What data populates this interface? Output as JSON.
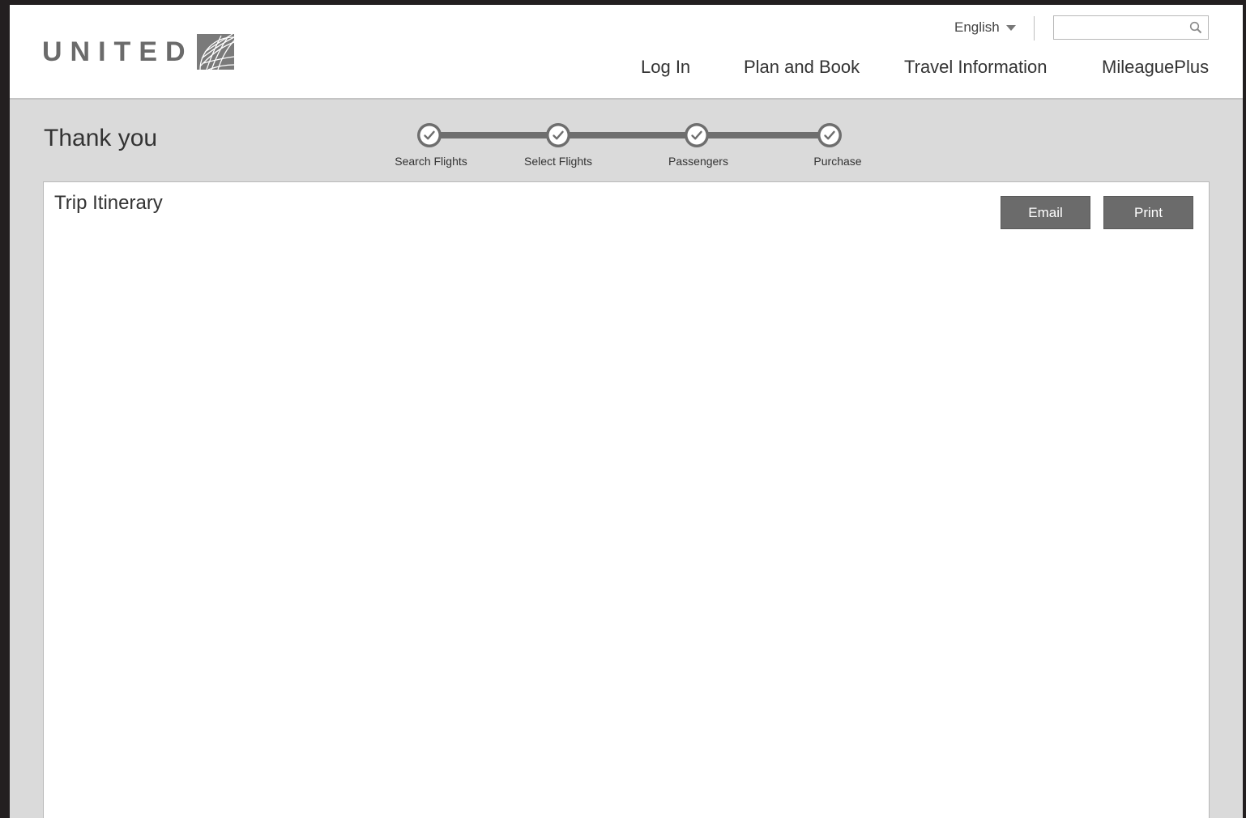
{
  "header": {
    "logo_text": "UNITED",
    "language": "English",
    "search": {
      "value": "",
      "placeholder": ""
    },
    "nav": [
      "Log In",
      "Plan and Book",
      "Travel Information",
      "MileaguePlus"
    ]
  },
  "page": {
    "title": "Thank you"
  },
  "progress": {
    "steps": [
      {
        "label": "Search Flights",
        "state": "complete"
      },
      {
        "label": "Select Flights",
        "state": "complete"
      },
      {
        "label": "Passengers",
        "state": "complete"
      },
      {
        "label": "Purchase",
        "state": "complete"
      }
    ]
  },
  "itinerary": {
    "title": "Trip Itinerary",
    "email_label": "Email",
    "print_label": "Print"
  },
  "icons": {
    "globe": "globe-logo-icon",
    "search": "search-icon",
    "caret": "caret-down-icon",
    "step": "checkmark-icon"
  },
  "colors": {
    "accent": "#6b6b6b",
    "background": "#dadada",
    "panel": "#ffffff"
  }
}
